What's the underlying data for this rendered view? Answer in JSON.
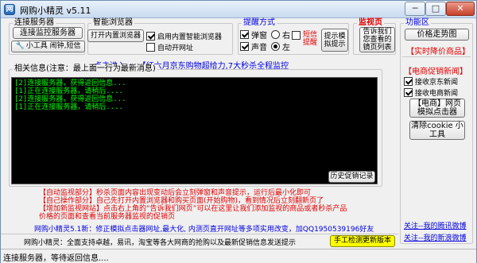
{
  "window": {
    "title": "网购小精灵 v5.11",
    "minimize_label": "─",
    "maximize_label": "□",
    "close_label": "✕"
  },
  "connect_group": {
    "title": "连接服务器",
    "monitor_button": "连接监控服务器",
    "tools_button": "小工具 闹钟,短信"
  },
  "browser_group": {
    "title": "智能浏览器",
    "open_button": "打开内置浏览器",
    "enable_checkbox": "启用内置智能浏览器",
    "auto_open_checkbox": "自动开网址"
  },
  "remind_group": {
    "title": "提醒方式",
    "popup_checkbox": "弹窗",
    "sound_checkbox": "声音",
    "radio_right": "右",
    "radio_left": "左",
    "sms_label": "短信提醒",
    "demo_button": "提示模拟提示"
  },
  "monitor_group": {
    "title": "监视页",
    "button": "告诉我们您查看的镜页列表"
  },
  "feature_group": {
    "title": "功能区",
    "price_chart_button": "价格走势图",
    "realtime_label": "【实时降价商品】",
    "promo_title": "【电商促销新闻】",
    "jd_news_checkbox": "接收京东新闻",
    "sn_news_checkbox": "接收电商新闻",
    "clicker_button": "【电商】网页模拟点击器",
    "cookie_button": "清除cookie 小工具"
  },
  "promo_link": "点击进入-->【红六月京东购物超给力,7大秒杀全程监控",
  "info_group": {
    "title": "相关信息(注意：最上面一行为最新消息)",
    "console_lines": [
      "[2]连接服务器，获得返回信息...",
      "[1]正在连接服务器，请稍后....",
      "[2]连接服务器，获得返回信息...",
      "[1]正在连接服务器，请稍后...."
    ],
    "history_button": "历史促销记录"
  },
  "notes": [
    "【自动监视部分】秒杀页面内容出现变动后会立刻弹窗和声音提示，运行后最小化即可",
    "【自己操作部分】自己先打开内置浏览器和购买页面(开始购物)，看到情况后立刻翻新页了",
    "【增加新监视网站】点击右上角的“告诉我们网页”可以在这里让我们添加监视的商品或者秒杀产品",
    "价格的页面和查看当前服务器监视的促销页"
  ],
  "qq_line": "网购小精灵5.1新：修正模拟点击器网址,最大化, 内测页直开网址等多项实用改变，加QQ1950539196好友",
  "footer_text": "网购小精灵：全面支持卓越，易讯，淘宝等各大网商的抢购以及最新促销信息发送提示",
  "manual_check_button": "手工检测更新版本",
  "link_tencent": "关注--我的腾讯微博",
  "link_sina": "关注--我的新浪微博",
  "status": "连接服务器，等待返回信息....",
  "colors": {
    "accent_red": "#e00000",
    "link_blue": "#0000e0",
    "console_bg": "#000000",
    "console_text": "#00ff00",
    "highlight_yellow": "#ffff00"
  }
}
